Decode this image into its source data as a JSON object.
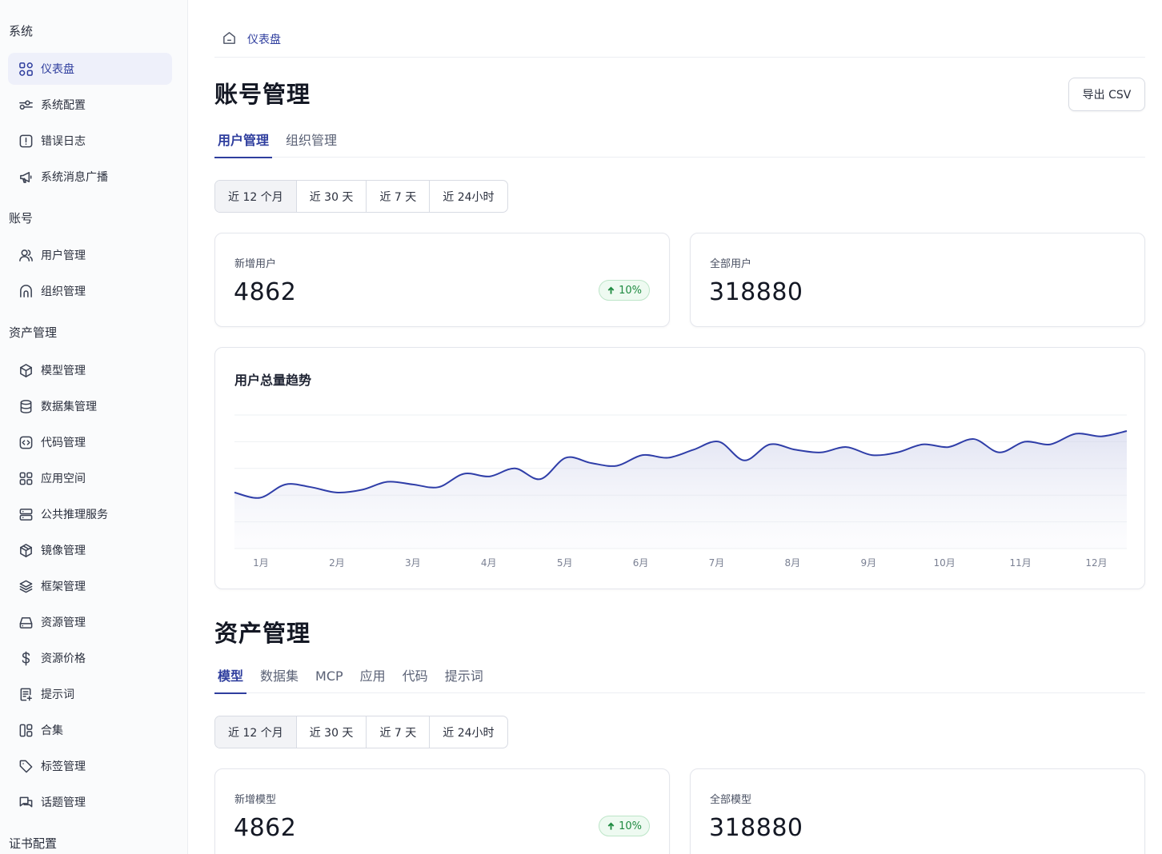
{
  "sidebar": {
    "groups": [
      {
        "title": "系统",
        "items": [
          {
            "label": "仪表盘",
            "icon": "dashboard-icon"
          },
          {
            "label": "系统配置",
            "icon": "settings-toggle-icon"
          },
          {
            "label": "错误日志",
            "icon": "alert-icon"
          },
          {
            "label": "系统消息广播",
            "icon": "megaphone-icon"
          }
        ]
      },
      {
        "title": "账号",
        "items": [
          {
            "label": "用户管理",
            "icon": "users-icon"
          },
          {
            "label": "组织管理",
            "icon": "org-icon"
          }
        ]
      },
      {
        "title": "资产管理",
        "items": [
          {
            "label": "模型管理",
            "icon": "cube-icon"
          },
          {
            "label": "数据集管理",
            "icon": "database-icon"
          },
          {
            "label": "代码管理",
            "icon": "code-icon"
          },
          {
            "label": "应用空间",
            "icon": "grid-icon"
          },
          {
            "label": "公共推理服务",
            "icon": "server-icon"
          },
          {
            "label": "镜像管理",
            "icon": "box-icon"
          },
          {
            "label": "框架管理",
            "icon": "layers-icon"
          },
          {
            "label": "资源管理",
            "icon": "drive-icon"
          },
          {
            "label": "资源价格",
            "icon": "dollar-icon"
          },
          {
            "label": "提示词",
            "icon": "prompt-icon"
          },
          {
            "label": "合集",
            "icon": "collection-icon"
          },
          {
            "label": "标签管理",
            "icon": "tag-icon"
          },
          {
            "label": "话题管理",
            "icon": "chat-icon"
          }
        ]
      },
      {
        "title": "证书配置",
        "items": []
      }
    ]
  },
  "breadcrumb": {
    "current": "仪表盘"
  },
  "export_label": "导出 CSV",
  "accounts": {
    "title": "账号管理",
    "tabs": [
      "用户管理",
      "组织管理"
    ],
    "ranges": [
      "近 12 个月",
      "近 30 天",
      "近 7 天",
      "近 24小时"
    ],
    "new_label": "新增用户",
    "new_value": "4862",
    "badge": "10%",
    "total_label": "全部用户",
    "total_value": "318880",
    "chart_title": "用户总量趋势"
  },
  "assets": {
    "title": "资产管理",
    "tabs": [
      "模型",
      "数据集",
      "MCP",
      "应用",
      "代码",
      "提示词"
    ],
    "ranges": [
      "近 12 个月",
      "近 30 天",
      "近 7 天",
      "近 24小时"
    ],
    "new_label": "新增模型",
    "new_value": "4862",
    "badge": "10%",
    "total_label": "全部模型",
    "total_value": "318880"
  },
  "chart_data": {
    "type": "area",
    "title": "用户总量趋势",
    "categories": [
      "1月",
      "2月",
      "3月",
      "4月",
      "5月",
      "6月",
      "7月",
      "8月",
      "9月",
      "10月",
      "11月",
      "12月"
    ],
    "values": [
      21,
      19,
      24,
      23,
      21,
      22,
      25,
      24,
      23,
      28,
      27,
      30,
      26,
      34,
      32,
      31,
      35,
      34,
      37,
      40,
      33,
      39,
      37,
      36,
      38,
      35,
      36,
      39,
      38,
      41,
      36,
      40,
      39,
      43,
      42,
      44
    ],
    "ylim": [
      0,
      50
    ],
    "color": "#2f3ea8",
    "grid": true
  }
}
